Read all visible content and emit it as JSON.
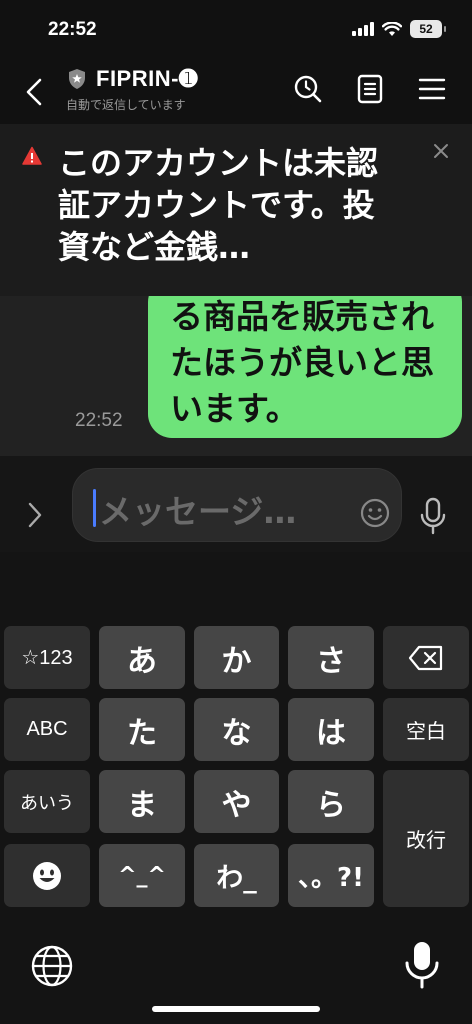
{
  "status": {
    "time": "22:52",
    "battery": "52"
  },
  "header": {
    "title": "FIPRIN-➊",
    "subtitle": "自動で返信しています"
  },
  "warning": {
    "text": "このアカウントは未認証アカウントです。投資など金銭…"
  },
  "chat": {
    "message": "る商品を販売されたほうが良いと思います。",
    "time": "22:52",
    "bubble_color": "#6ee37a"
  },
  "composer": {
    "placeholder": "メッセージ…"
  },
  "keyboard": {
    "keys": {
      "symbols": "☆123",
      "a": "あ",
      "ka": "か",
      "sa": "さ",
      "abc": "ABC",
      "ta": "た",
      "na": "な",
      "ha": "は",
      "space": "空白",
      "aiu": "あいう",
      "ma": "ま",
      "ya": "や",
      "ra": "ら",
      "enter": "改行",
      "kaomoji": "^_^",
      "wa": "わ_",
      "punct": "、。?!"
    }
  }
}
